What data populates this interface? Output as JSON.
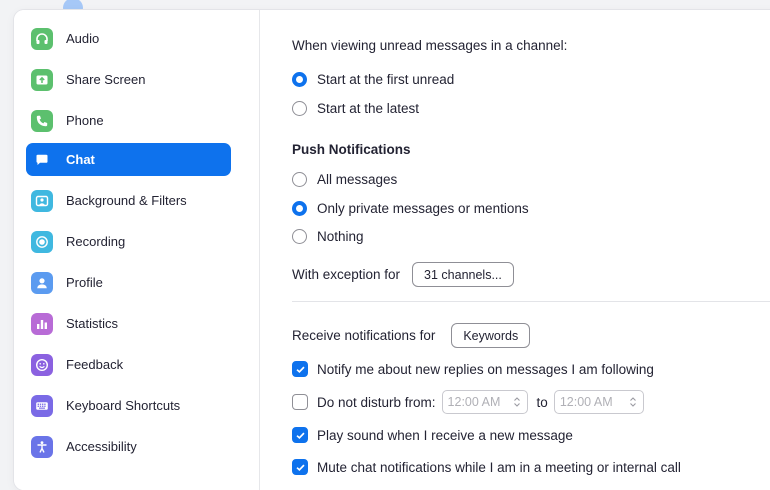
{
  "sidebar": {
    "items": [
      {
        "label": "Audio",
        "icon": "headphones-icon",
        "color": "#5cc06e"
      },
      {
        "label": "Share Screen",
        "icon": "share-screen-icon",
        "color": "#5cc06e"
      },
      {
        "label": "Phone",
        "icon": "phone-icon",
        "color": "#5cc06e"
      },
      {
        "label": "Chat",
        "icon": "chat-icon",
        "color": "#0e72ed",
        "active": true
      },
      {
        "label": "Background & Filters",
        "icon": "background-icon",
        "color": "#3fb8e0"
      },
      {
        "label": "Recording",
        "icon": "recording-icon",
        "color": "#3fb8e0"
      },
      {
        "label": "Profile",
        "icon": "profile-icon",
        "color": "#5b9bf0"
      },
      {
        "label": "Statistics",
        "icon": "statistics-icon",
        "color": "#b86bd6"
      },
      {
        "label": "Feedback",
        "icon": "feedback-icon",
        "color": "#8b61e0"
      },
      {
        "label": "Keyboard Shortcuts",
        "icon": "keyboard-icon",
        "color": "#7a6ae6"
      },
      {
        "label": "Accessibility",
        "icon": "accessibility-icon",
        "color": "#6a74e8"
      }
    ]
  },
  "chat_settings": {
    "unread_heading": "When viewing unread messages in a channel:",
    "unread_options": [
      {
        "label": "Start at the first unread",
        "selected": true
      },
      {
        "label": "Start at the latest",
        "selected": false
      }
    ],
    "push_title": "Push Notifications",
    "push_options": [
      {
        "label": "All messages",
        "selected": false
      },
      {
        "label": "Only private messages or mentions",
        "selected": true
      },
      {
        "label": "Nothing",
        "selected": false
      }
    ],
    "exception_label": "With exception for",
    "exception_button": "31 channels...",
    "receive_label": "Receive notifications for",
    "receive_button": "Keywords",
    "notify_replies": {
      "label": "Notify me about new replies on messages I am following",
      "checked": true
    },
    "dnd": {
      "label": "Do not disturb from:",
      "checked": false,
      "from": "12:00 AM",
      "to_label": "to",
      "to": "12:00 AM"
    },
    "play_sound": {
      "label": "Play sound when I receive a new message",
      "checked": true
    },
    "mute_meeting": {
      "label": "Mute chat notifications while I am in a meeting or internal call",
      "checked": true
    }
  },
  "colors": {
    "accent": "#0e72ed"
  }
}
